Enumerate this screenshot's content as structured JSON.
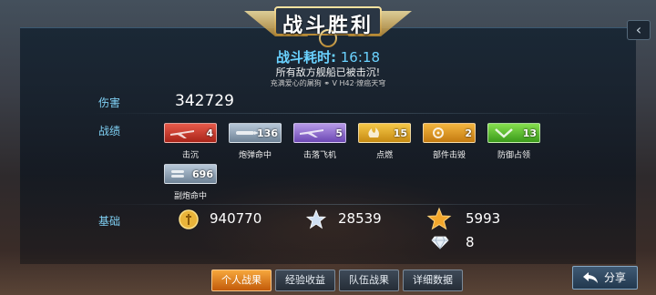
{
  "header": {
    "title": "战斗胜利",
    "time_label": "战斗耗时:",
    "time_value": "16:18",
    "message": "所有敌方舰船已被击沉!",
    "player_line": "充满爱心的屠狗 ⚭   V   H42·燎癌天穹"
  },
  "rows": {
    "damage_label": "伤害",
    "damage_value": "342729",
    "record_label": "战绩",
    "basic_label": "基础"
  },
  "medals": [
    {
      "label": "击沉",
      "count": "4",
      "color": "red",
      "icon": "plane-icon"
    },
    {
      "label": "炮弹命中",
      "count": "136",
      "color": "silver",
      "icon": "shell-icon"
    },
    {
      "label": "击落飞机",
      "count": "5",
      "color": "purple",
      "icon": "plane-icon"
    },
    {
      "label": "点燃",
      "count": "15",
      "color": "gold",
      "icon": "fire-icon"
    },
    {
      "label": "部件击毁",
      "count": "2",
      "color": "gold",
      "icon": "gear-icon"
    },
    {
      "label": "防御占领",
      "count": "13",
      "color": "green",
      "icon": "chevron-icon"
    },
    {
      "label": "副炮命中",
      "count": "696",
      "color": "silver",
      "icon": "shell-icon"
    }
  ],
  "resources": {
    "coins": "940770",
    "stars": "28539",
    "gold_star": "5993",
    "diamond": "8"
  },
  "tabs": [
    "个人战果",
    "经验收益",
    "队伍战果",
    "详细数据"
  ],
  "active_tab": "个人战果",
  "share_label": "分享",
  "close_symbol": "‹"
}
